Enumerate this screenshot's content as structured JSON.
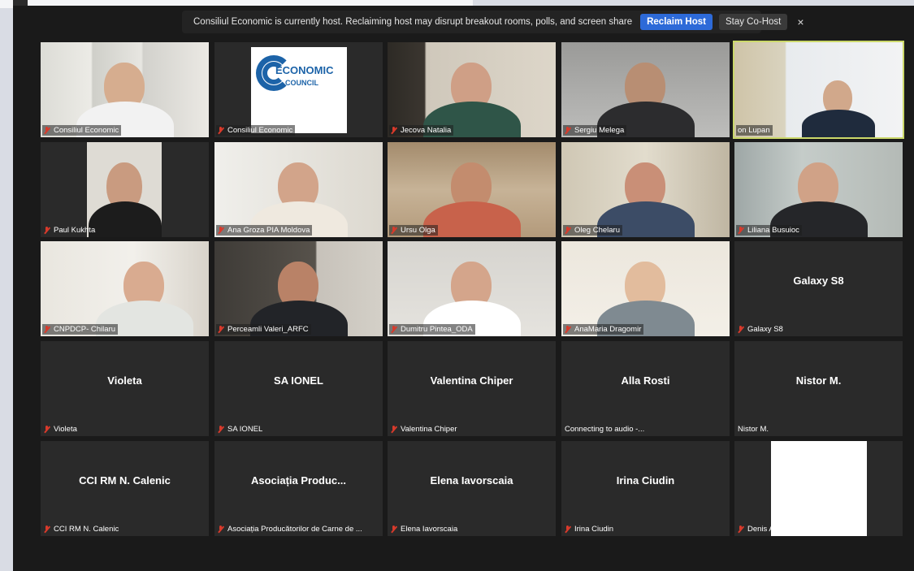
{
  "banner": {
    "message": "Consiliul Economic is currently host. Reclaiming host may disrupt breakout rooms, polls, and screen share",
    "reclaim_label": "Reclaim Host",
    "stay_label": "Stay Co-Host",
    "close_label": "×"
  },
  "logo_text": {
    "line1": "ECONOMIC",
    "line2": "COUNCIL"
  },
  "tiles": [
    {
      "label": "Consiliul Economic",
      "video": true
    },
    {
      "label": "Consiliul Economic",
      "video": true
    },
    {
      "label": "Jecova Natalia",
      "video": true
    },
    {
      "label": "Sergiu Melega",
      "video": true
    },
    {
      "label": "on Lupan",
      "video": true,
      "active": true
    },
    {
      "label": "Paul Kukhta",
      "video": true
    },
    {
      "label": "Ana Groza PIA Moldova",
      "video": true
    },
    {
      "label": "Ursu Olga",
      "video": true
    },
    {
      "label": "Oleg Chelaru",
      "video": true
    },
    {
      "label": "Liliana Busuioc",
      "video": true
    },
    {
      "label": "CNPDCP- Chilaru",
      "video": true
    },
    {
      "label": "Perceamli Valeri_ARFC",
      "video": true
    },
    {
      "label": "Dumitru Pintea_ODA",
      "video": true
    },
    {
      "label": "AnaMaria Dragomir",
      "video": true
    },
    {
      "name": "Galaxy S8",
      "label": "Galaxy S8"
    },
    {
      "name": "Violeta",
      "label": "Violeta"
    },
    {
      "name": "SA IONEL",
      "label": "SA IONEL"
    },
    {
      "name": "Valentina Chiper",
      "label": "Valentina Chiper"
    },
    {
      "name": "Alla Rosti",
      "label": "Connecting to audio -..."
    },
    {
      "name": "Nistor M.",
      "label": "Nistor M."
    },
    {
      "name": "CCI RM N. Calenic",
      "label": "CCI RM N. Calenic"
    },
    {
      "name": "Asociația Produc...",
      "label": "Asociația Producătorilor de Carne de ..."
    },
    {
      "name": "Elena Iavorscaia",
      "label": "Elena Iavorscaia"
    },
    {
      "name": "Irina Ciudin",
      "label": "Irina Ciudin"
    },
    {
      "label": "Denis Andries",
      "video": true
    }
  ]
}
